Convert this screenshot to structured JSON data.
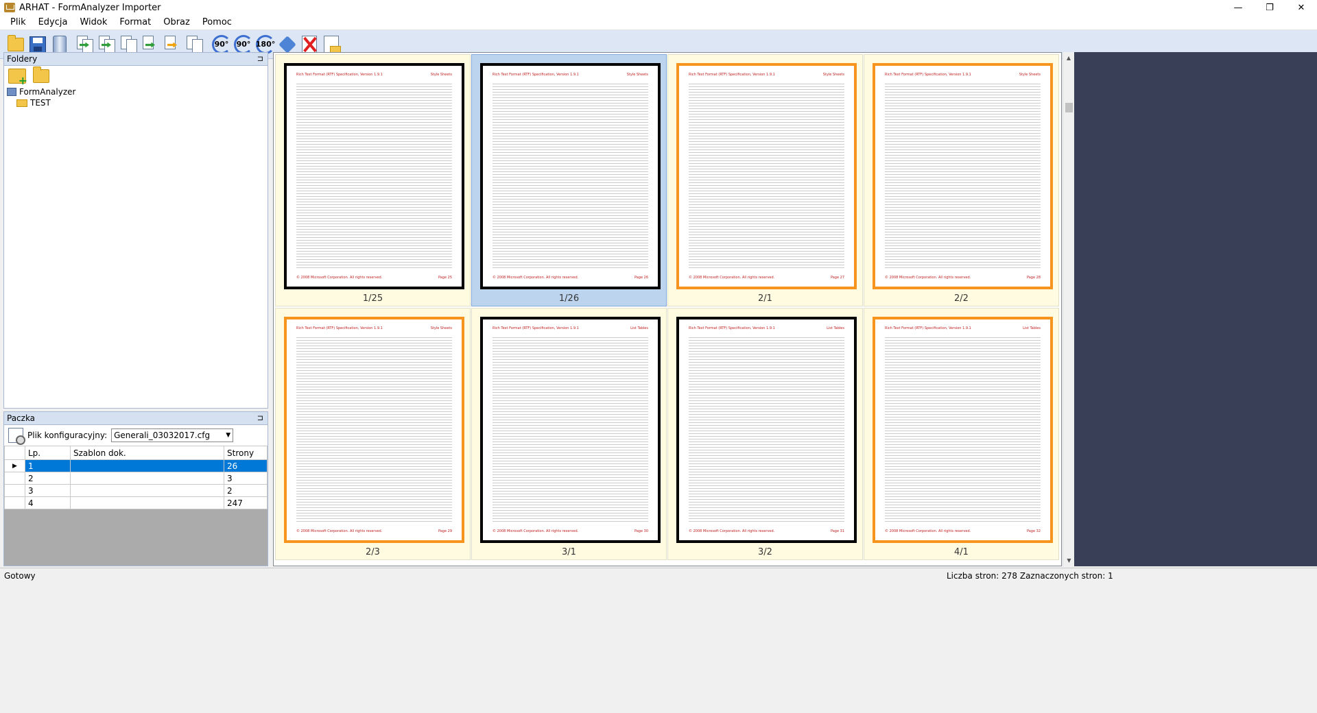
{
  "window": {
    "title": "ARHAT - FormAnalyzer Importer",
    "minimize": "—",
    "maximize": "❐",
    "close": "✕"
  },
  "menu": [
    {
      "label": "Plik"
    },
    {
      "label": "Edycja"
    },
    {
      "label": "Widok"
    },
    {
      "label": "Format"
    },
    {
      "label": "Obraz"
    },
    {
      "label": "Pomoc"
    }
  ],
  "toolbar": {
    "rotate_90_cw": "90°",
    "rotate_90_ccw": "90°",
    "rotate_180": "180°"
  },
  "folders": {
    "header": "Foldery",
    "pin": "⊐",
    "tree": [
      {
        "label": "FormAnalyzer",
        "level": 0
      },
      {
        "label": "TEST",
        "level": 1
      }
    ]
  },
  "paczka": {
    "header": "Paczka",
    "pin": "⊐",
    "config_label": "Plik konfiguracyjny:",
    "config_value": "Generali_03032017.cfg",
    "dropdown_arrow": "▼",
    "columns": [
      "Lp.",
      "Szablon dok.",
      "Strony"
    ],
    "rows": [
      {
        "lp": "1",
        "template": "",
        "pages": "26",
        "selected": true
      },
      {
        "lp": "2",
        "template": "",
        "pages": "3",
        "selected": false
      },
      {
        "lp": "3",
        "template": "",
        "pages": "2",
        "selected": false
      },
      {
        "lp": "4",
        "template": "",
        "pages": "247",
        "selected": false
      }
    ],
    "row_marker": "▶"
  },
  "thumbnails": [
    {
      "label": "1/25",
      "header_left": "Rich Text Format (RTF) Specification, Version 1.9.1",
      "header_right": "Style Sheets",
      "footer_left": "© 2008 Microsoft Corporation. All rights reserved.",
      "footer_right": "Page 25",
      "border": "black",
      "selected": false
    },
    {
      "label": "1/26",
      "header_left": "Rich Text Format (RTF) Specification, Version 1.9.1",
      "header_right": "Style Sheets",
      "footer_left": "© 2008 Microsoft Corporation. All rights reserved.",
      "footer_right": "Page 26",
      "border": "black",
      "selected": true
    },
    {
      "label": "2/1",
      "header_left": "Rich Text Format (RTF) Specification, Version 1.9.1",
      "header_right": "Style Sheets",
      "footer_left": "© 2008 Microsoft Corporation. All rights reserved.",
      "footer_right": "Page 27",
      "border": "orange",
      "selected": false
    },
    {
      "label": "2/2",
      "header_left": "Rich Text Format (RTF) Specification, Version 1.9.1",
      "header_right": "Style Sheets",
      "footer_left": "© 2008 Microsoft Corporation. All rights reserved.",
      "footer_right": "Page 28",
      "border": "orange",
      "selected": false
    },
    {
      "label": "2/3",
      "header_left": "Rich Text Format (RTF) Specification, Version 1.9.1",
      "header_right": "Style Sheets",
      "footer_left": "© 2008 Microsoft Corporation. All rights reserved.",
      "footer_right": "Page 29",
      "border": "orange",
      "selected": false
    },
    {
      "label": "3/1",
      "header_left": "Rich Text Format (RTF) Specification, Version 1.9.1",
      "header_right": "List Tables",
      "footer_left": "© 2008 Microsoft Corporation. All rights reserved.",
      "footer_right": "Page 30",
      "border": "black",
      "selected": false
    },
    {
      "label": "3/2",
      "header_left": "Rich Text Format (RTF) Specification, Version 1.9.1",
      "header_right": "List Tables",
      "footer_left": "© 2008 Microsoft Corporation. All rights reserved.",
      "footer_right": "Page 31",
      "border": "black",
      "selected": false
    },
    {
      "label": "4/1",
      "header_left": "Rich Text Format (RTF) Specification, Version 1.9.1",
      "header_right": "List Tables",
      "footer_left": "© 2008 Microsoft Corporation. All rights reserved.",
      "footer_right": "Page 32",
      "border": "orange",
      "selected": false
    }
  ],
  "status": {
    "left": "Gotowy",
    "right": "Liczba stron: 278   Zaznaczonych stron: 1"
  },
  "scrollbar": {
    "up": "▲",
    "down": "▼"
  },
  "colors": {
    "selected_row": "#0078d7",
    "thumb_bg": "#fffbe0",
    "thumb_selected": "#bcd4ee",
    "page_orange": "#f7941d"
  }
}
